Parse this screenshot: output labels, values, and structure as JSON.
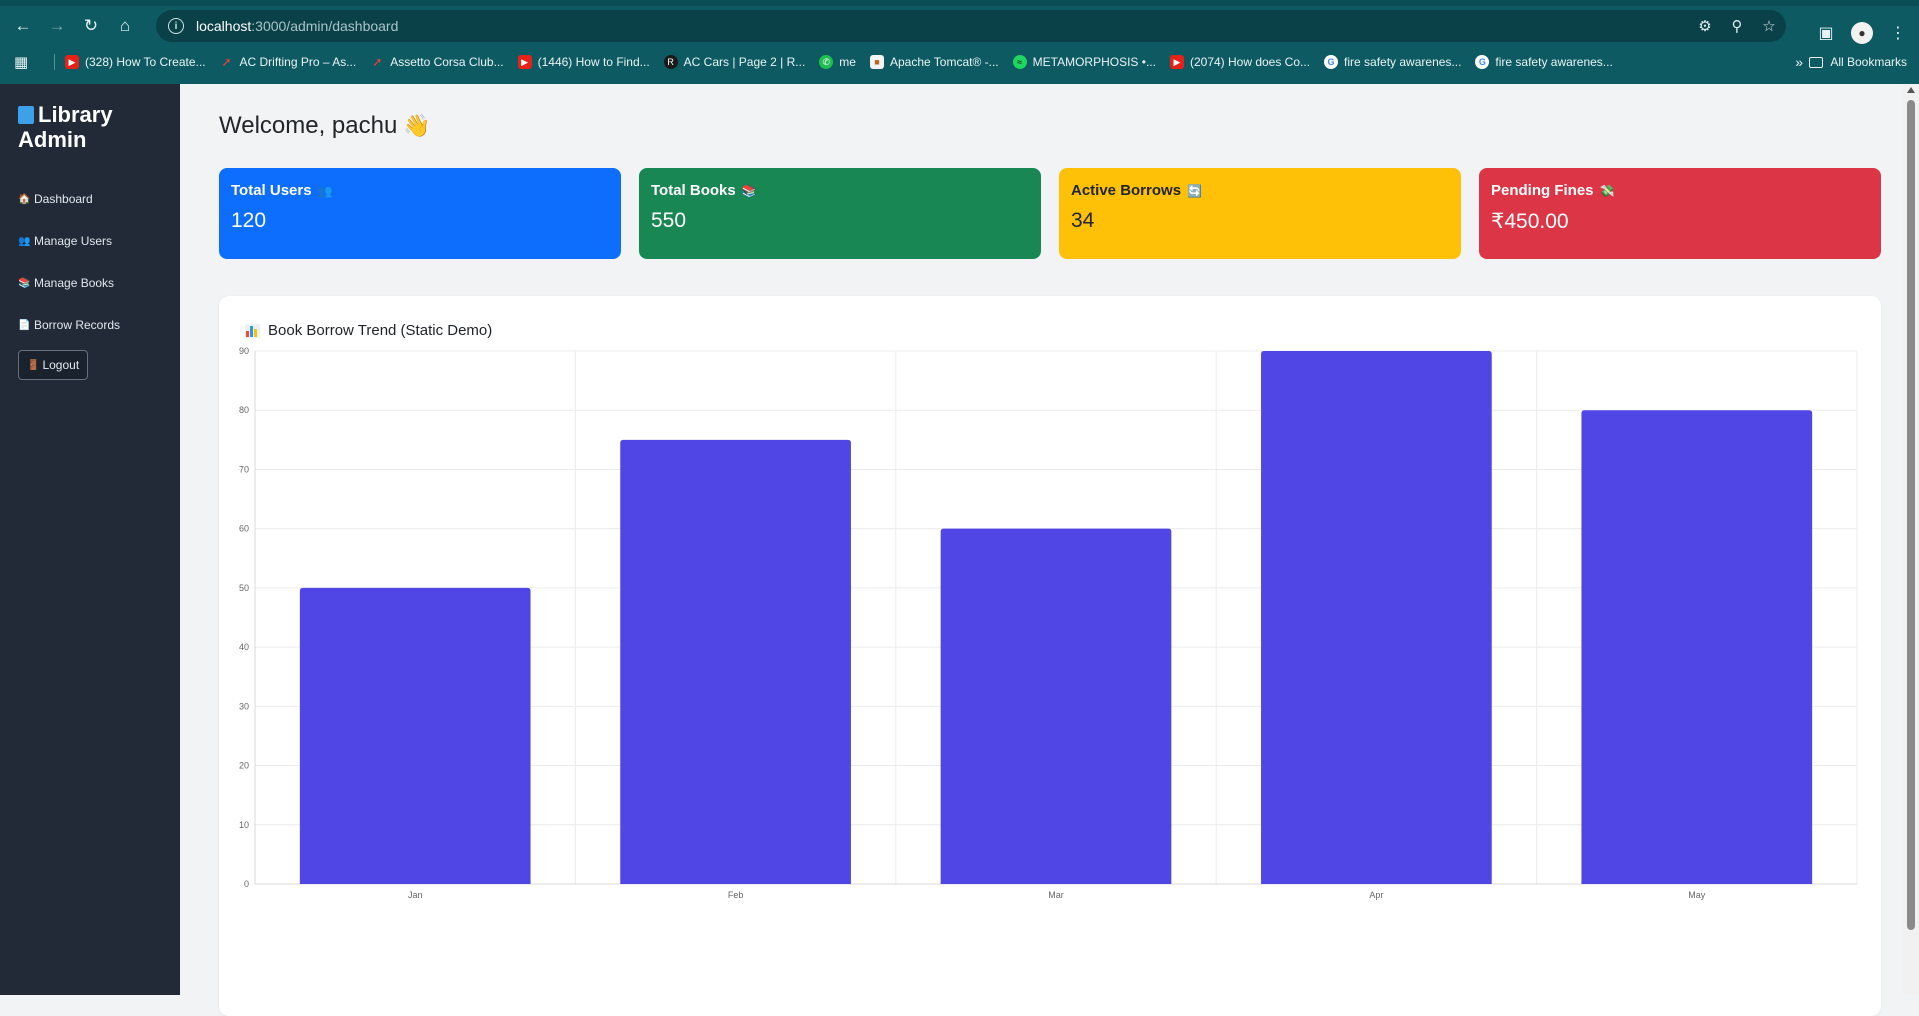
{
  "browser": {
    "url_host": "localhost",
    "url_path": ":3000/admin/dashboard",
    "bookmarks": [
      {
        "label": "(328) How To Create...",
        "icon": "youtube-icon"
      },
      {
        "label": "AC Drifting Pro – As...",
        "icon": "ac-icon"
      },
      {
        "label": "Assetto Corsa Club...",
        "icon": "ac-icon"
      },
      {
        "label": "(1446) How to Find...",
        "icon": "youtube-icon"
      },
      {
        "label": "AC Cars | Page 2 | R...",
        "icon": "racedepartment-icon"
      },
      {
        "label": "me",
        "icon": "whatsapp-icon"
      },
      {
        "label": "Apache Tomcat® -...",
        "icon": "tomcat-icon"
      },
      {
        "label": "METAMORPHOSIS •...",
        "icon": "spotify-icon"
      },
      {
        "label": "(2074) How does Co...",
        "icon": "youtube-icon"
      },
      {
        "label": "fire safety awarenes...",
        "icon": "google-icon"
      },
      {
        "label": "fire safety awarenes...",
        "icon": "google-icon"
      }
    ],
    "all_bookmarks_label": "All Bookmarks"
  },
  "sidebar": {
    "brand": "Library Admin",
    "items": [
      {
        "label": "Dashboard",
        "icon": "house-icon"
      },
      {
        "label": "Manage Users",
        "icon": "users-icon"
      },
      {
        "label": "Manage Books",
        "icon": "books-icon"
      },
      {
        "label": "Borrow Records",
        "icon": "document-icon"
      }
    ],
    "logout_label": "Logout"
  },
  "main": {
    "welcome": "Welcome, pachu",
    "cards": [
      {
        "label": "Total Users",
        "value": "120",
        "color": "#0d6efd"
      },
      {
        "label": "Total Books",
        "value": "550",
        "color": "#198754"
      },
      {
        "label": "Active Borrows",
        "value": "34",
        "color": "#ffc107"
      },
      {
        "label": "Pending Fines",
        "value": "₹450.00",
        "color": "#dc3545"
      }
    ],
    "chart_title": "Book Borrow Trend (Static Demo)"
  },
  "chart_data": {
    "type": "bar",
    "categories": [
      "Jan",
      "Feb",
      "Mar",
      "Apr",
      "May"
    ],
    "values": [
      50,
      75,
      60,
      90,
      80
    ],
    "title": "Book Borrow Trend (Static Demo)",
    "xlabel": "",
    "ylabel": "",
    "ylim": [
      0,
      90
    ],
    "yticks": [
      0,
      10,
      20,
      30,
      40,
      50,
      60,
      70,
      80,
      90
    ],
    "grid": true,
    "legend": "none",
    "bar_color": "#4f46e5"
  }
}
